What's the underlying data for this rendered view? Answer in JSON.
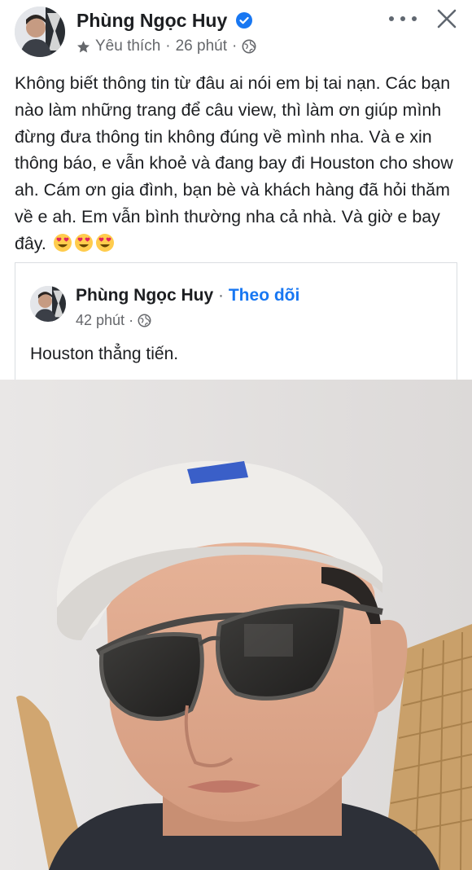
{
  "post": {
    "author": "Phùng Ngọc Huy",
    "meta": {
      "reaction_label": "Yêu thích",
      "separator": "·",
      "time": "26 phút",
      "separator2": "·"
    },
    "text": "Không biết thông tin từ đâu ai nói em bị tai nạn. Các bạn nào làm những trang để câu view, thì làm ơn giúp mình đừng đưa thông tin không đúng về mình nha. Và e xin thông báo, e vẫn khoẻ và đang bay đi Houston cho show ah. Cám ơn gia đình, bạn bè và khách hàng đã hỏi thăm về e ah. Em vẫn bình thường nha cả nhà. Và giờ e bay đây.",
    "emojis": [
      "heart-eyes",
      "heart-eyes",
      "heart-eyes"
    ]
  },
  "shared_post": {
    "author": "Phùng Ngọc Huy",
    "separator": "·",
    "follow_label": "Theo dõi",
    "time": "42 phút",
    "time_separator": "·",
    "text": "Houston thẳng tiến."
  },
  "icons": {
    "verified": "verified-badge-icon",
    "star": "star-icon",
    "globe": "globe-icon",
    "more": "more-horizontal-icon",
    "close": "close-icon"
  },
  "colors": {
    "accent": "#1877f2",
    "meta_text": "#65676b",
    "text": "#1c1e21"
  }
}
